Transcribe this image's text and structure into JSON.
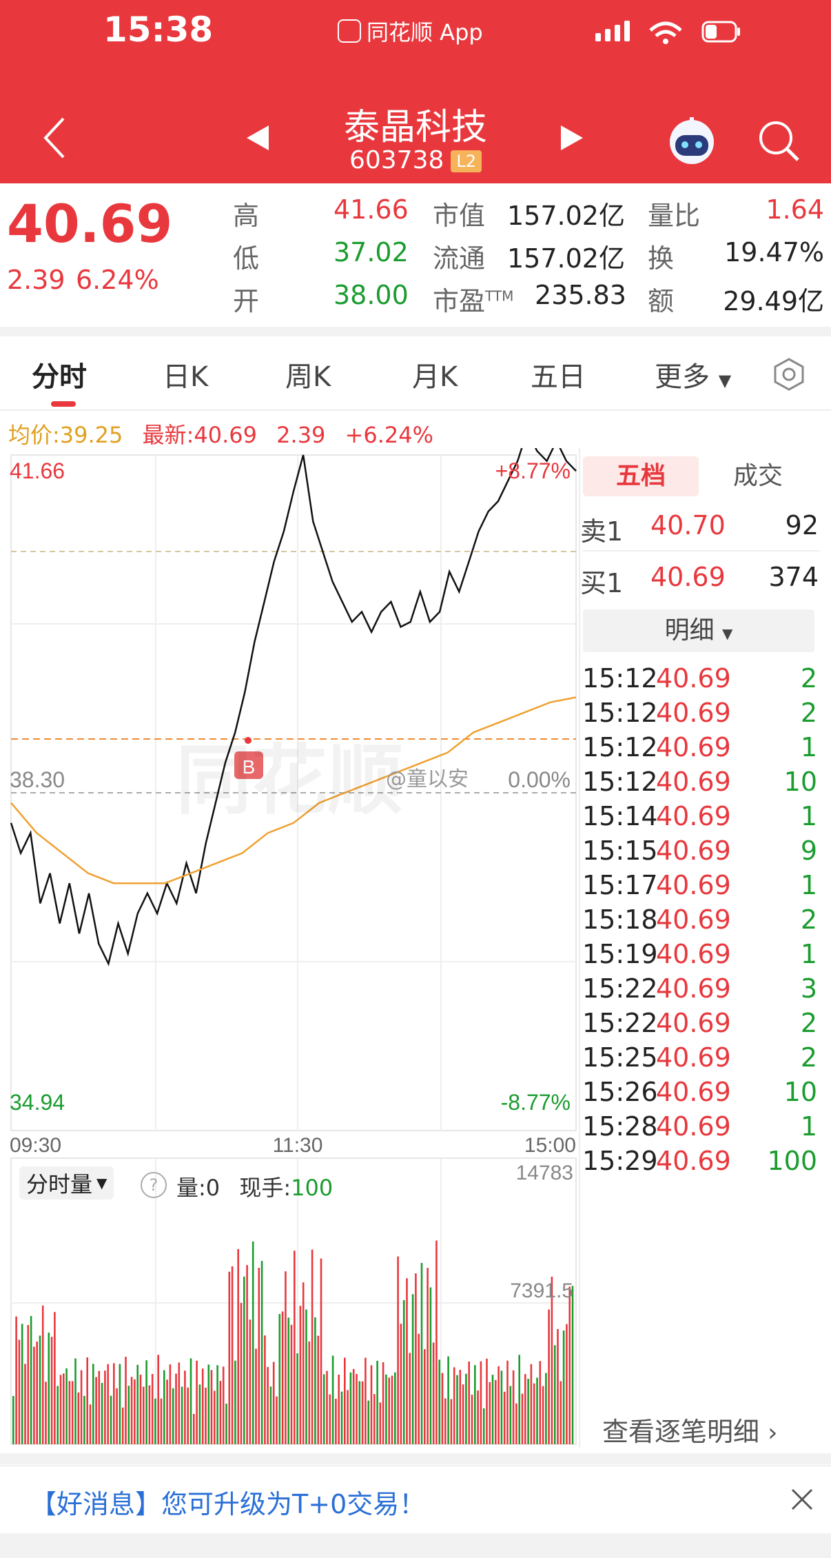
{
  "status_bar": {
    "time": "15:38",
    "app_label": "同花顺 App"
  },
  "stock": {
    "name": "泰晶科技",
    "code": "603738",
    "level_badge": "L2"
  },
  "quote": {
    "price": "40.69",
    "change": "2.39",
    "change_pct": "6.24%",
    "labels": {
      "high": "高",
      "low": "低",
      "open": "开",
      "mkt_cap": "市值",
      "float_cap": "流通",
      "pe": "市盈",
      "pe_sup": "TTM",
      "vol_ratio": "量比",
      "turnover": "换",
      "amount": "额"
    },
    "high": "41.66",
    "low": "37.02",
    "open": "38.00",
    "mkt_cap": "157.02亿",
    "float_cap": "157.02亿",
    "pe": "235.83",
    "vol_ratio": "1.64",
    "turnover": "19.47%",
    "amount": "29.49亿"
  },
  "tabs": [
    {
      "label": "分时"
    },
    {
      "label": "日K"
    },
    {
      "label": "周K"
    },
    {
      "label": "月K"
    },
    {
      "label": "五日"
    },
    {
      "label": "更多"
    }
  ],
  "info_line": {
    "avg": "均价:39.25",
    "last": "最新:40.69",
    "change": "2.39",
    "pct": "+6.24%"
  },
  "chart_data": {
    "type": "line",
    "price_axis": {
      "top": "41.66",
      "mid": "38.30",
      "bottom": "34.94",
      "top_pct": "+8.77%",
      "mid_pct": "0.00%",
      "bottom_pct": "-8.77%"
    },
    "ylim": [
      34.94,
      41.66
    ],
    "prev_close": 38.3,
    "last_price": 40.69,
    "x_ticks": [
      "09:30",
      "11:30",
      "15:00"
    ],
    "series": [
      {
        "values": [
          38.0,
          37.7,
          37.9,
          37.2,
          37.5,
          37.0,
          37.4,
          36.9,
          37.3,
          36.8,
          36.6,
          37.0,
          36.7,
          37.1,
          37.3,
          37.1,
          37.4,
          37.2,
          37.6,
          37.3,
          37.8,
          38.2,
          38.6,
          38.9,
          39.3,
          39.8,
          40.2,
          40.6,
          40.9,
          41.3,
          41.66,
          41.0,
          40.7,
          40.4,
          40.2,
          40.0,
          40.1,
          39.9,
          40.1,
          40.2,
          39.95,
          40.0,
          40.3,
          40.0,
          40.1,
          40.5,
          40.3,
          40.6,
          40.9,
          41.1,
          41.2,
          41.4,
          41.6,
          41.9,
          41.7,
          41.6,
          41.8,
          41.6,
          41.5
        ],
        "note": ""
      },
      {
        "values": [
          38.2,
          37.9,
          37.7,
          37.5,
          37.4,
          37.4,
          37.4,
          37.5,
          37.6,
          37.7,
          37.9,
          38.0,
          38.2,
          38.3,
          38.4,
          38.5,
          38.6,
          38.7,
          38.9,
          39.0,
          39.1,
          39.2,
          39.25
        ]
      }
    ],
    "cost_line": 38.67,
    "buy_marker": "B",
    "watermark": "同花顺",
    "weibo_tag": "@童以安"
  },
  "volume_panel": {
    "selector": "分时量",
    "vol_label": "量:",
    "vol_value": "0",
    "hand_label": "现手:",
    "hand_value": "100",
    "max": "14783",
    "mid": "7391.5"
  },
  "depth": {
    "tab_active": "五档",
    "tab_other": "成交",
    "sell_label": "卖1",
    "sell_price": "40.70",
    "sell_vol": "92",
    "buy_label": "买1",
    "buy_price": "40.69",
    "buy_vol": "374",
    "detail_label": "明细"
  },
  "trades": [
    {
      "time": "15:12",
      "price": "40.69",
      "vol": "2"
    },
    {
      "time": "15:12",
      "price": "40.69",
      "vol": "2"
    },
    {
      "time": "15:12",
      "price": "40.69",
      "vol": "1"
    },
    {
      "time": "15:12",
      "price": "40.69",
      "vol": "10"
    },
    {
      "time": "15:14",
      "price": "40.69",
      "vol": "1"
    },
    {
      "time": "15:15",
      "price": "40.69",
      "vol": "9"
    },
    {
      "time": "15:17",
      "price": "40.69",
      "vol": "1"
    },
    {
      "time": "15:18",
      "price": "40.69",
      "vol": "2"
    },
    {
      "time": "15:19",
      "price": "40.69",
      "vol": "1"
    },
    {
      "time": "15:22",
      "price": "40.69",
      "vol": "3"
    },
    {
      "time": "15:22",
      "price": "40.69",
      "vol": "2"
    },
    {
      "time": "15:25",
      "price": "40.69",
      "vol": "2"
    },
    {
      "time": "15:26",
      "price": "40.69",
      "vol": "10"
    },
    {
      "time": "15:28",
      "price": "40.69",
      "vol": "1"
    },
    {
      "time": "15:29",
      "price": "40.69",
      "vol": "100"
    }
  ],
  "more_trades": "查看逐笔明细",
  "banner": {
    "tag": "【好消息】",
    "text": "您可升级为T+0交易！"
  },
  "colors": {
    "brand_red": "#e8383d",
    "green": "#1a9c2f",
    "avg_line": "#f0a030"
  }
}
